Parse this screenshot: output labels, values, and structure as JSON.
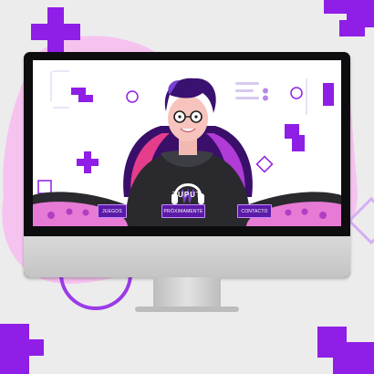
{
  "colors": {
    "accent": "#8f1ee6",
    "pink": "#f6c3f0",
    "background": "#ececec",
    "button": "#5b1aa8"
  },
  "icons": {
    "monitor": "monitor-icon",
    "headphones": "headphones-icon"
  },
  "screen": {
    "logo_text": "TUPUT",
    "nav": {
      "juegos": "JUEGOS",
      "proximamente": "PRÓXIMAMENTE",
      "contacto": "CONTACTO"
    }
  }
}
